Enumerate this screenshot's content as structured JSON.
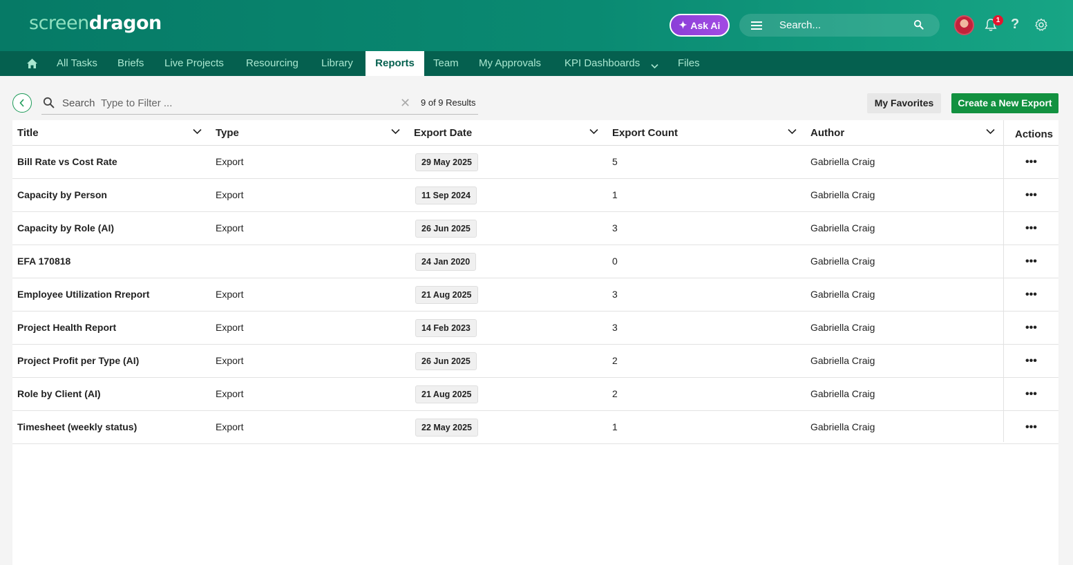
{
  "brand": {
    "logo_part1": "screen",
    "logo_part2": "dragon"
  },
  "header": {
    "ask_ai_label": "Ask Ai",
    "search_placeholder": "Search...",
    "notification_count": "1",
    "help_label": "?"
  },
  "nav": {
    "items": [
      {
        "label": "All Tasks"
      },
      {
        "label": "Briefs"
      },
      {
        "label": "Live Projects"
      },
      {
        "label": "Resourcing"
      },
      {
        "label": "Library"
      },
      {
        "label": "Reports",
        "active": true
      },
      {
        "label": "Team"
      },
      {
        "label": "My Approvals"
      },
      {
        "label": "KPI Dashboards"
      },
      {
        "label": "Files"
      }
    ]
  },
  "toolbar": {
    "search_label": "Search",
    "filter_placeholder": "Type to Filter ...",
    "results_text": "9 of 9 Results",
    "favorites_label": "My Favorites",
    "create_label": "Create a New Export"
  },
  "table": {
    "columns": [
      "Title",
      "Type",
      "Export Date",
      "Export Count",
      "Author",
      "Actions"
    ],
    "rows": [
      {
        "title": "Bill Rate vs Cost Rate",
        "type": "Export",
        "date": "29 May 2025",
        "count": "5",
        "author": "Gabriella Craig"
      },
      {
        "title": "Capacity by Person",
        "type": "Export",
        "date": "11 Sep 2024",
        "count": "1",
        "author": "Gabriella Craig"
      },
      {
        "title": "Capacity by Role (AI)",
        "type": "Export",
        "date": "26 Jun 2025",
        "count": "3",
        "author": "Gabriella Craig"
      },
      {
        "title": "EFA 170818",
        "type": "",
        "date": "24 Jan 2020",
        "count": "0",
        "author": "Gabriella Craig"
      },
      {
        "title": "Employee Utilization Rreport",
        "type": "Export",
        "date": "21 Aug 2025",
        "count": "3",
        "author": "Gabriella Craig"
      },
      {
        "title": "Project Health Report",
        "type": "Export",
        "date": "14 Feb 2023",
        "count": "3",
        "author": "Gabriella Craig"
      },
      {
        "title": "Project Profit per Type (AI)",
        "type": "Export",
        "date": "26 Jun 2025",
        "count": "2",
        "author": "Gabriella Craig"
      },
      {
        "title": "Role by Client (AI)",
        "type": "Export",
        "date": "21 Aug 2025",
        "count": "2",
        "author": "Gabriella Craig"
      },
      {
        "title": "Timesheet (weekly status)",
        "type": "Export",
        "date": "22 May 2025",
        "count": "1",
        "author": "Gabriella Craig"
      }
    ],
    "row_action_label": "•••"
  },
  "colors": {
    "header_bg": "#067a66",
    "nav_bg": "#05604f",
    "primary_button": "#129140",
    "ask_ai": "#8b3fd8",
    "badge": "#e3152e"
  }
}
